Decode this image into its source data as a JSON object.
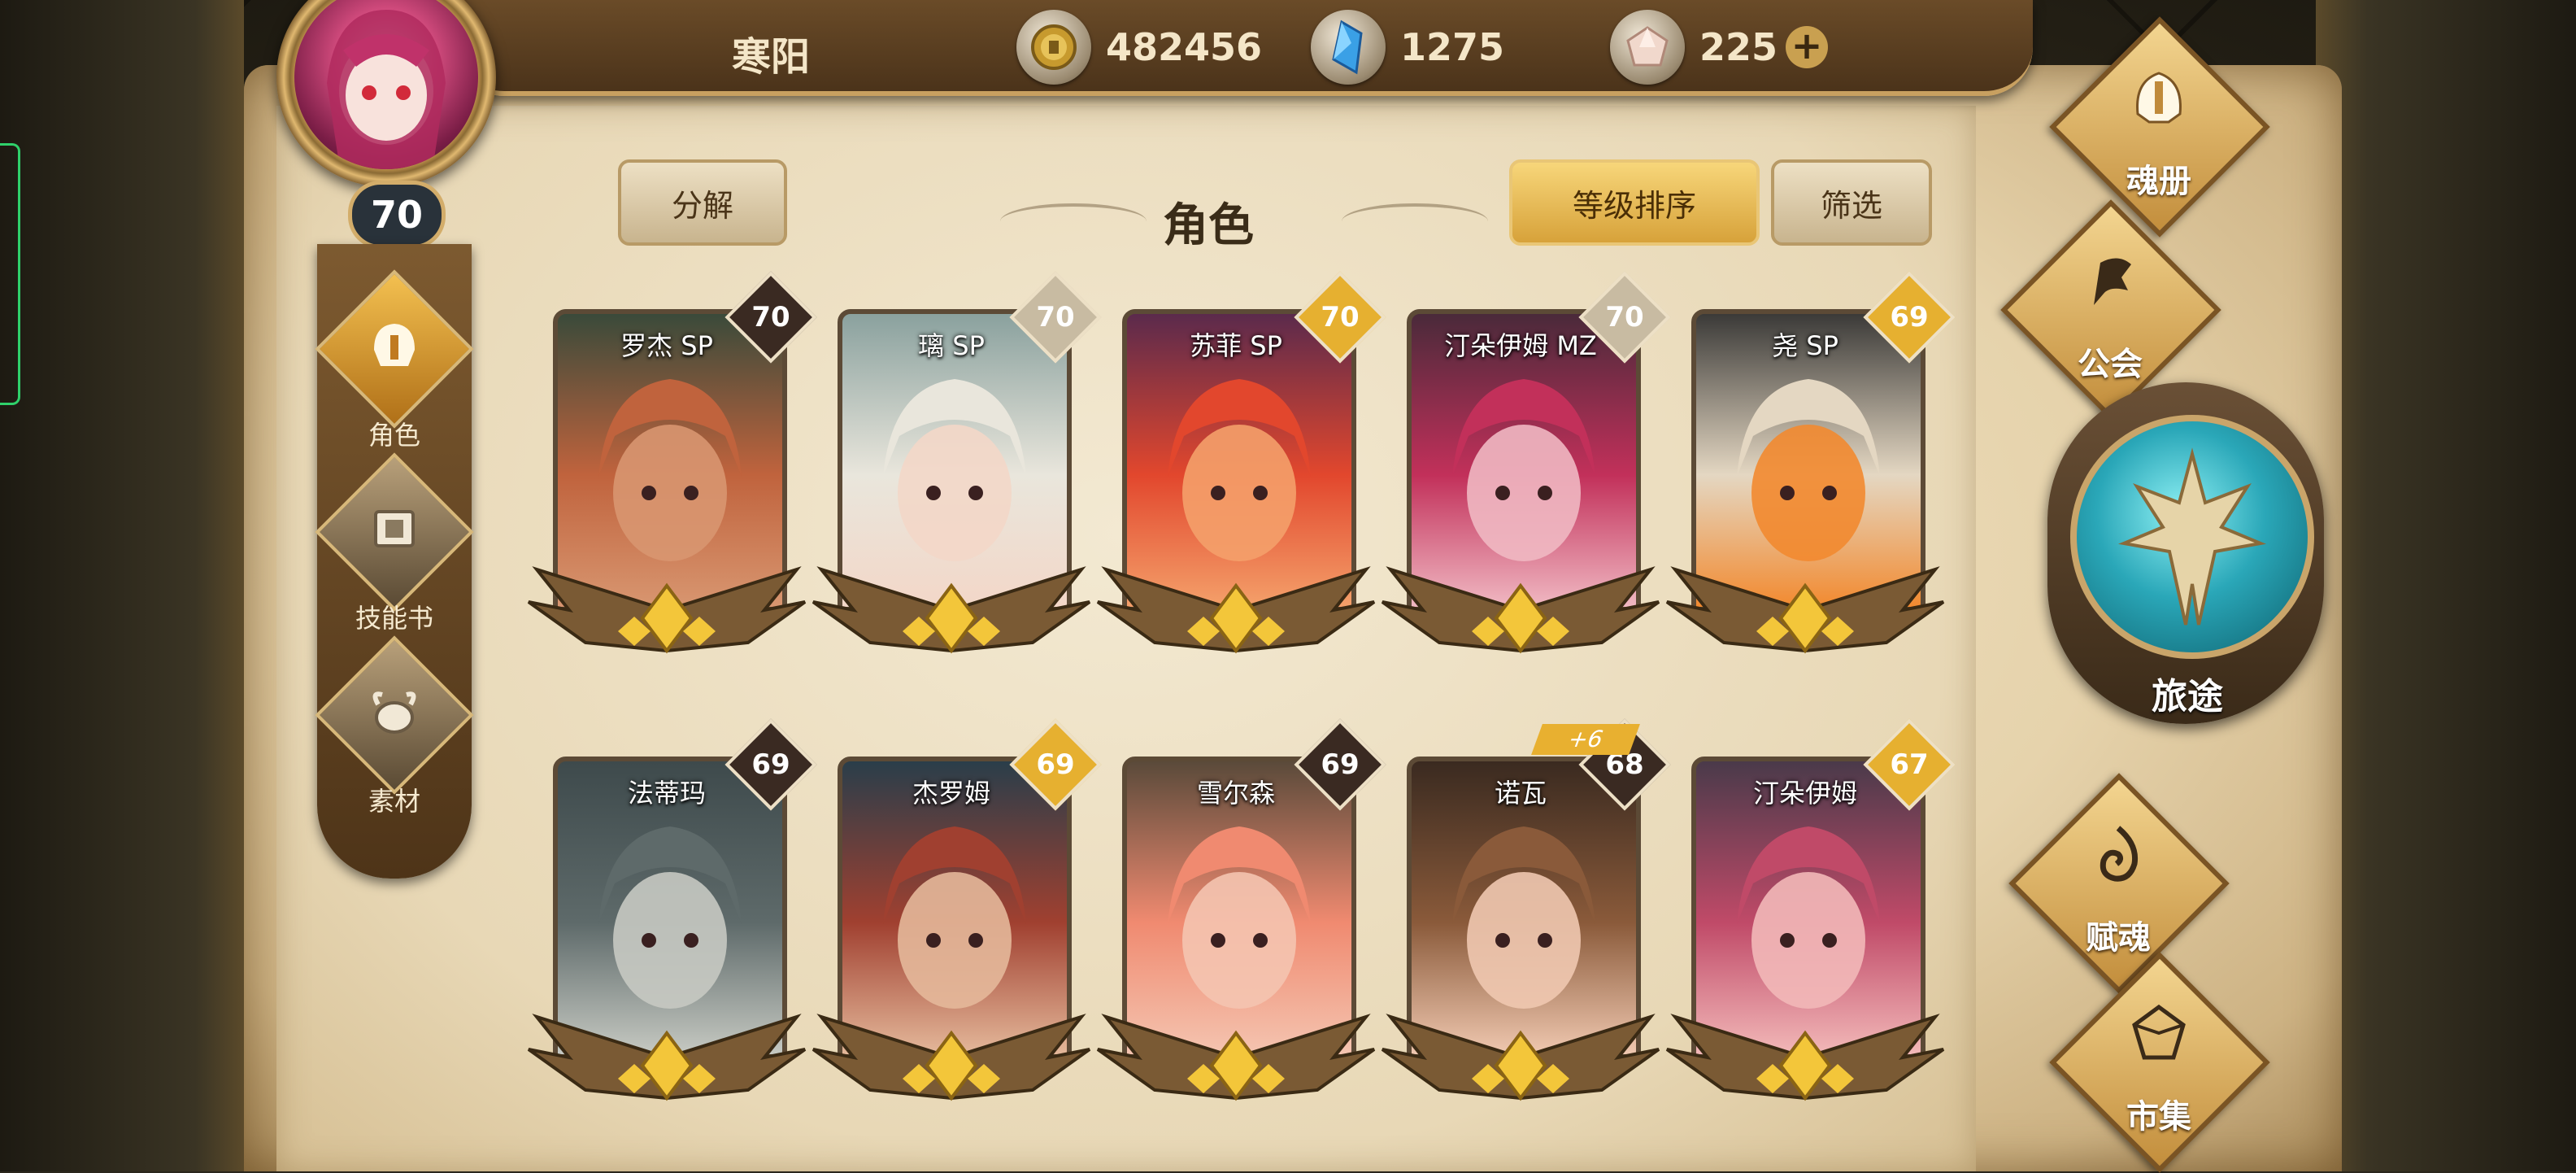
{
  "player": {
    "name": "寒阳",
    "level": "70"
  },
  "resources": {
    "gold": {
      "icon": "gold-coin-icon",
      "value": "482456"
    },
    "crystal": {
      "icon": "blue-crystal-icon",
      "value": "1275"
    },
    "gem": {
      "icon": "pink-gem-icon",
      "value": "225",
      "add_label": "+"
    }
  },
  "left_nav": [
    {
      "label": "角色",
      "icon": "helmet-icon",
      "active": true
    },
    {
      "label": "技能书",
      "icon": "skill-book-icon",
      "active": false
    },
    {
      "label": "素材",
      "icon": "material-pot-icon",
      "active": false
    }
  ],
  "header": {
    "title": "角色",
    "decompose_label": "分解",
    "sort_label": "等级排序",
    "filter_label": "筛选"
  },
  "characters": [
    {
      "name": "罗杰 SP",
      "level": "70",
      "badge": "dark",
      "palette": [
        "#3a4a3a",
        "#c0633d",
        "#d89670"
      ]
    },
    {
      "name": "璃 SP",
      "level": "70",
      "badge": "light",
      "palette": [
        "#8aa19e",
        "#e9e6dc",
        "#f3d7c8"
      ]
    },
    {
      "name": "苏菲 SP",
      "level": "70",
      "badge": "gold",
      "palette": [
        "#5b2a4c",
        "#e2472d",
        "#f4a06a"
      ]
    },
    {
      "name": "汀朵伊姆 MZ",
      "level": "70",
      "badge": "light",
      "palette": [
        "#4a2a3a",
        "#c2305a",
        "#f0b8c2"
      ]
    },
    {
      "name": "尧 SP",
      "level": "69",
      "badge": "gold",
      "palette": [
        "#3b3a38",
        "#e4d7c2",
        "#f28a30"
      ]
    },
    {
      "name": "法蒂玛",
      "level": "69",
      "badge": "dark",
      "palette": [
        "#3e4a4c",
        "#5e6a6a",
        "#c6c9c2"
      ]
    },
    {
      "name": "杰罗姆",
      "level": "69",
      "badge": "gold",
      "palette": [
        "#2a3e4a",
        "#a04030",
        "#e4b89a"
      ]
    },
    {
      "name": "雪尔森",
      "level": "69",
      "badge": "dark",
      "palette": [
        "#5a4a3a",
        "#f08a70",
        "#f4c4b0"
      ]
    },
    {
      "name": "诺瓦",
      "level": "68",
      "badge": "dark",
      "bonus": "+6",
      "palette": [
        "#3a2a20",
        "#8a5a3a",
        "#f0c8b0"
      ]
    },
    {
      "name": "汀朵伊姆",
      "level": "67",
      "badge": "gold",
      "palette": [
        "#4a3a4a",
        "#c04a68",
        "#f2b8b8"
      ]
    }
  ],
  "right_nav": {
    "soul_book": {
      "label": "魂册",
      "icon": "soul-book-icon"
    },
    "guild": {
      "label": "公会",
      "icon": "guild-banner-icon"
    },
    "journey": {
      "label": "旅途",
      "icon": "journey-emblem-icon"
    },
    "soul_grant": {
      "label": "赋魂",
      "icon": "flame-swirl-icon"
    },
    "market": {
      "label": "市集",
      "icon": "market-gem-icon"
    }
  }
}
